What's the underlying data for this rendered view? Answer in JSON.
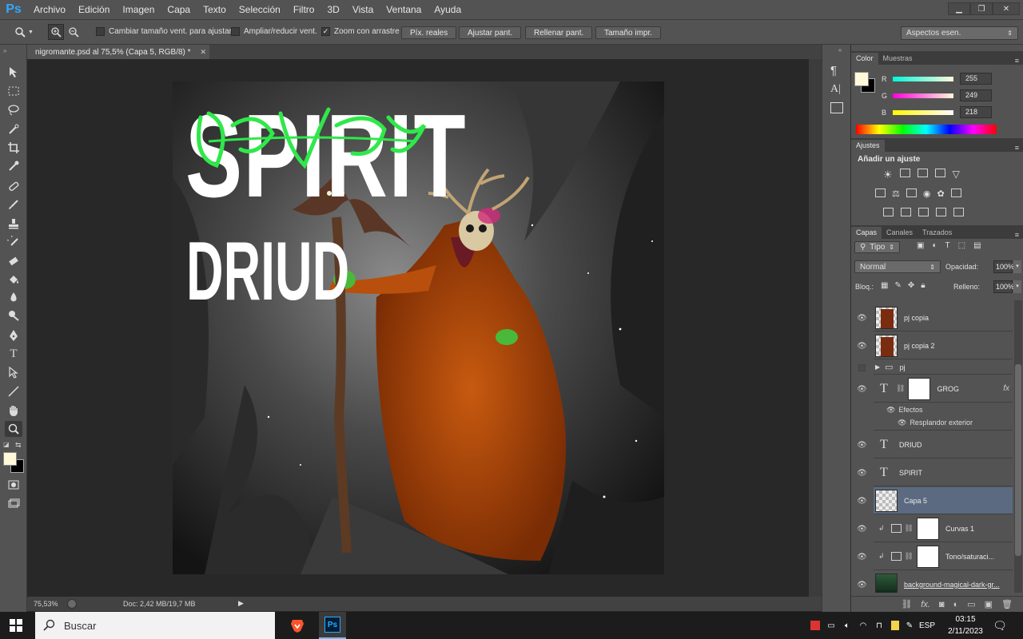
{
  "app": {
    "logo": "Ps"
  },
  "menu": [
    "Archivo",
    "Edición",
    "Imagen",
    "Capa",
    "Texto",
    "Selección",
    "Filtro",
    "3D",
    "Vista",
    "Ventana",
    "Ayuda"
  ],
  "window_controls": {
    "minimize": "▁",
    "restore": "❐",
    "close": "✕"
  },
  "options": {
    "resize_windows": {
      "label": "Cambiar tamaño vent. para ajustar",
      "checked": false
    },
    "zoom_all": {
      "label": "Ampliar/reducir vent.",
      "checked": false
    },
    "scrubby_zoom": {
      "label": "Zoom con arrastre",
      "checked": true
    },
    "buttons": [
      "Píx. reales",
      "Ajustar pant.",
      "Rellenar pant.",
      "Tamaño impr."
    ],
    "workspace": "Aspectos esen."
  },
  "document": {
    "tab_title": "nigromante.psd al 75,5% (Capa 5, RGB/8) *",
    "zoom": "75,53%",
    "doc_size": "Doc: 2,42 MB/19,7 MB"
  },
  "artwork": {
    "title_word1": "SPIRIT",
    "title_word2": "DRIUD",
    "graffiti": "GROG"
  },
  "color_panel": {
    "tabs": [
      "Color",
      "Muestras"
    ],
    "r_label": "R",
    "g_label": "G",
    "b_label": "B",
    "r": "255",
    "g": "249",
    "b": "218",
    "fg_color": "#fff9da",
    "bg_color": "#000000"
  },
  "adjustments_panel": {
    "tab": "Ajustes",
    "title": "Añadir un ajuste"
  },
  "layers_panel": {
    "tabs": [
      "Capas",
      "Canales",
      "Trazados"
    ],
    "filter_kind": "Tipo",
    "blend_mode": "Normal",
    "opacity_label": "Opacidad:",
    "opacity": "100%",
    "lock_label": "Bloq.:",
    "fill_label": "Relleno:",
    "fill": "100%",
    "layers": [
      {
        "name": "pj copia",
        "type": "image"
      },
      {
        "name": "pj copia 2",
        "type": "image"
      },
      {
        "name": "pj",
        "type": "group"
      },
      {
        "name": "GROG",
        "type": "text-fx",
        "effects_label": "Efectos",
        "effect": "Resplandor exterior"
      },
      {
        "name": "DRIUD",
        "type": "text"
      },
      {
        "name": "SPIRIT",
        "type": "text"
      },
      {
        "name": "Capa 5",
        "type": "empty",
        "selected": true
      },
      {
        "name": "Curvas 1",
        "type": "adjustment"
      },
      {
        "name": "Tono/saturaci...",
        "type": "adjustment"
      },
      {
        "name": "background-magical-dark-gr...",
        "type": "image"
      }
    ]
  },
  "taskbar": {
    "search_placeholder": "Buscar",
    "language": "ESP",
    "time": "03:15",
    "date": "2/11/2023"
  }
}
